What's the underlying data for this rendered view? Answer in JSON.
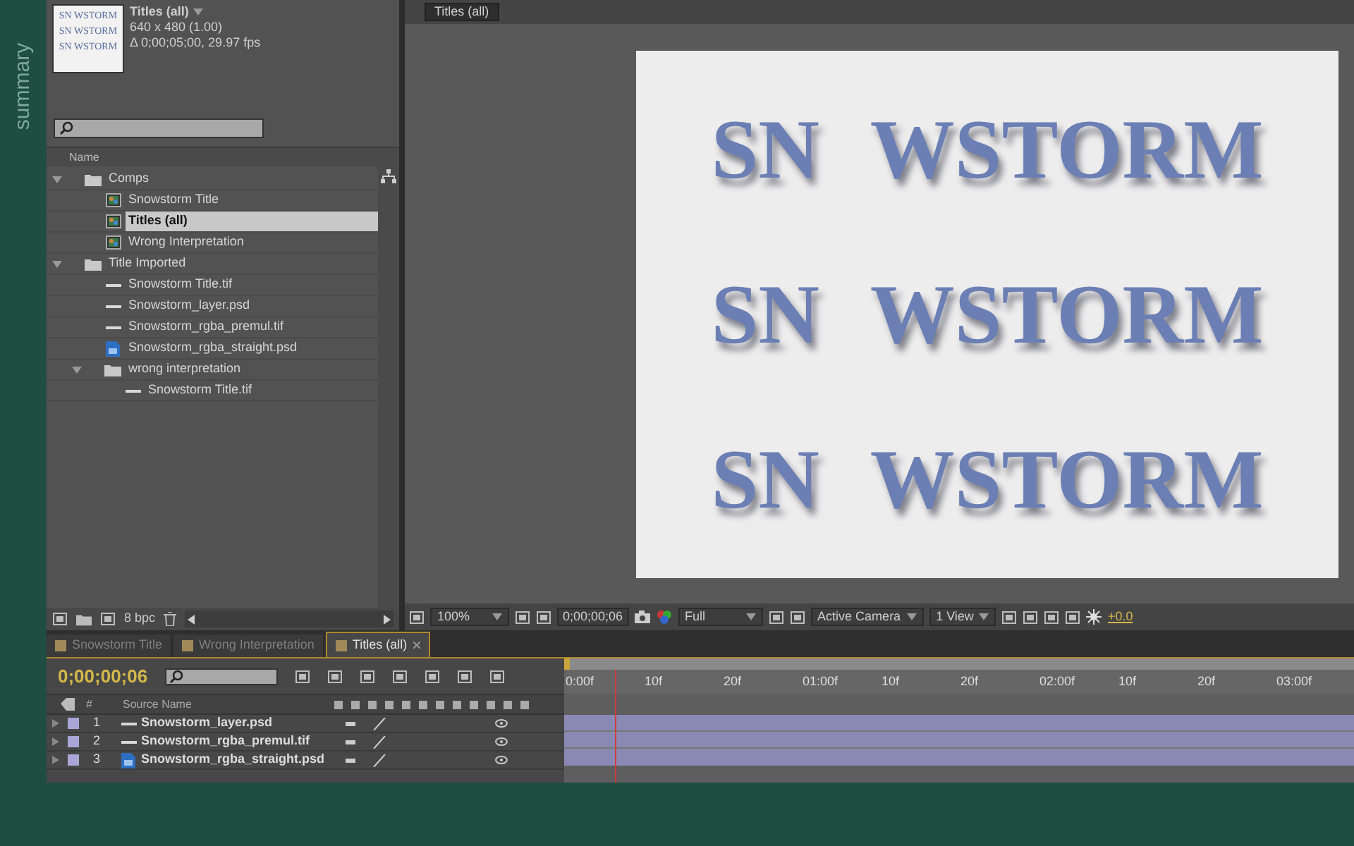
{
  "side_label": "summary",
  "project": {
    "thumbnail_lines": [
      "SN WSTORM",
      "SN WSTORM",
      "SN WSTORM"
    ],
    "comp_name": "Titles (all)",
    "info_lines": [
      "640 x 480 (1.00)",
      "Δ 0;00;05;00, 29.97 fps"
    ],
    "column": "Name",
    "bpc": "8 bpc",
    "tree": [
      {
        "label": "Comps",
        "kind": "folder",
        "expanded": true,
        "selected": false,
        "children": [
          {
            "label": "Snowstorm Title",
            "kind": "comp",
            "selected": false
          },
          {
            "label": "Titles (all)",
            "kind": "comp",
            "selected": true
          },
          {
            "label": "Wrong Interpretation",
            "kind": "comp",
            "selected": false
          }
        ]
      },
      {
        "label": "Title Imported",
        "kind": "folder",
        "expanded": true,
        "selected": false,
        "children": [
          {
            "label": "Snowstorm Title.tif",
            "kind": "footage",
            "selected": false
          },
          {
            "label": "Snowstorm_layer.psd",
            "kind": "footage",
            "selected": false
          },
          {
            "label": "Snowstorm_rgba_premul.tif",
            "kind": "footage",
            "selected": false
          },
          {
            "label": "Snowstorm_rgba_straight.psd",
            "kind": "psd",
            "selected": false
          },
          {
            "label": "wrong interpretation",
            "kind": "folder",
            "expanded": true,
            "selected": false,
            "children": [
              {
                "label": "Snowstorm Title.tif",
                "kind": "footage",
                "selected": false
              }
            ]
          }
        ]
      }
    ]
  },
  "viewer": {
    "tab": "Titles (all)",
    "preview_lines": [
      "SN WSTORM",
      "SN WSTORM",
      "SN WSTORM"
    ],
    "toolbar": {
      "zoom": "100%",
      "timecode": "0;00;00;06",
      "resolution": "Full",
      "camera": "Active Camera",
      "view": "1 View",
      "exposure": "+0.0"
    }
  },
  "timeline": {
    "tabs": [
      {
        "label": "Snowstorm Title",
        "selected": false
      },
      {
        "label": "Wrong Interpretation",
        "selected": false
      },
      {
        "label": "Titles (all)",
        "selected": true
      }
    ],
    "timecode": "0;00;00;06",
    "columns": [
      "#",
      "Source Name"
    ],
    "layers": [
      {
        "number": "1",
        "name": "Snowstorm_layer.psd",
        "kind": "footage"
      },
      {
        "number": "2",
        "name": "Snowstorm_rgba_premul.tif",
        "kind": "footage"
      },
      {
        "number": "3",
        "name": "Snowstorm_rgba_straight.psd",
        "kind": "psd"
      }
    ],
    "ruler": [
      "0:00f",
      "10f",
      "20f",
      "01:00f",
      "10f",
      "20f",
      "02:00f",
      "10f",
      "20f",
      "03:00f"
    ]
  }
}
